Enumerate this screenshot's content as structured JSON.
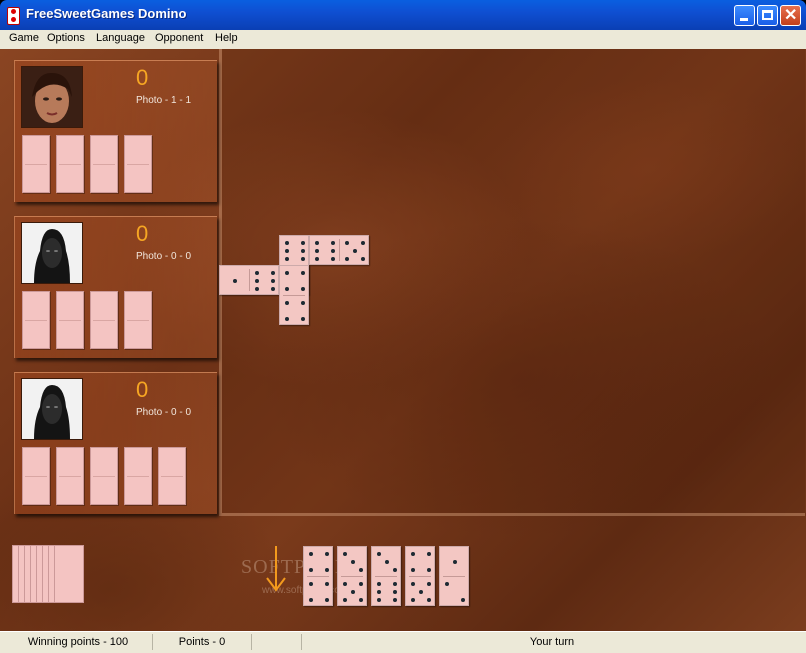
{
  "window": {
    "title": "FreeSweetGames Domino"
  },
  "menu": {
    "items": [
      "Game",
      "Options",
      "Language",
      "Opponent",
      "Help"
    ]
  },
  "players": [
    {
      "score": "0",
      "label": "Photo - 1 - 1",
      "avatar": "woman-face",
      "tiles": 4
    },
    {
      "score": "0",
      "label": "Photo - 0 - 0",
      "avatar": "man-face",
      "tiles": 4
    },
    {
      "score": "0",
      "label": "Photo - 0 - 0",
      "avatar": "man-face",
      "tiles": 5
    }
  ],
  "board_tiles": [
    {
      "orient": "h",
      "a": 1,
      "b": 6
    },
    {
      "orient": "v",
      "a": 6,
      "b": 6
    },
    {
      "orient": "h",
      "a": 6,
      "b": 5
    },
    {
      "orient": "v",
      "a": 4,
      "b": 4
    }
  ],
  "player_hand": [
    {
      "a": 4,
      "b": 4
    },
    {
      "a": 3,
      "b": 5
    },
    {
      "a": 3,
      "b": 6
    },
    {
      "a": 4,
      "b": 5
    },
    {
      "a": 1,
      "b": 2
    }
  ],
  "stock_count": 8,
  "watermark": {
    "brand": "SOFTPEDIA",
    "url": "www.softpedia.com"
  },
  "status": {
    "winning": "Winning points - 100",
    "points": "Points - 0",
    "turn": "Your turn"
  },
  "colors": {
    "score": "#f6a623",
    "tile": "#f3c7c3",
    "pip": "#1d2a33"
  }
}
